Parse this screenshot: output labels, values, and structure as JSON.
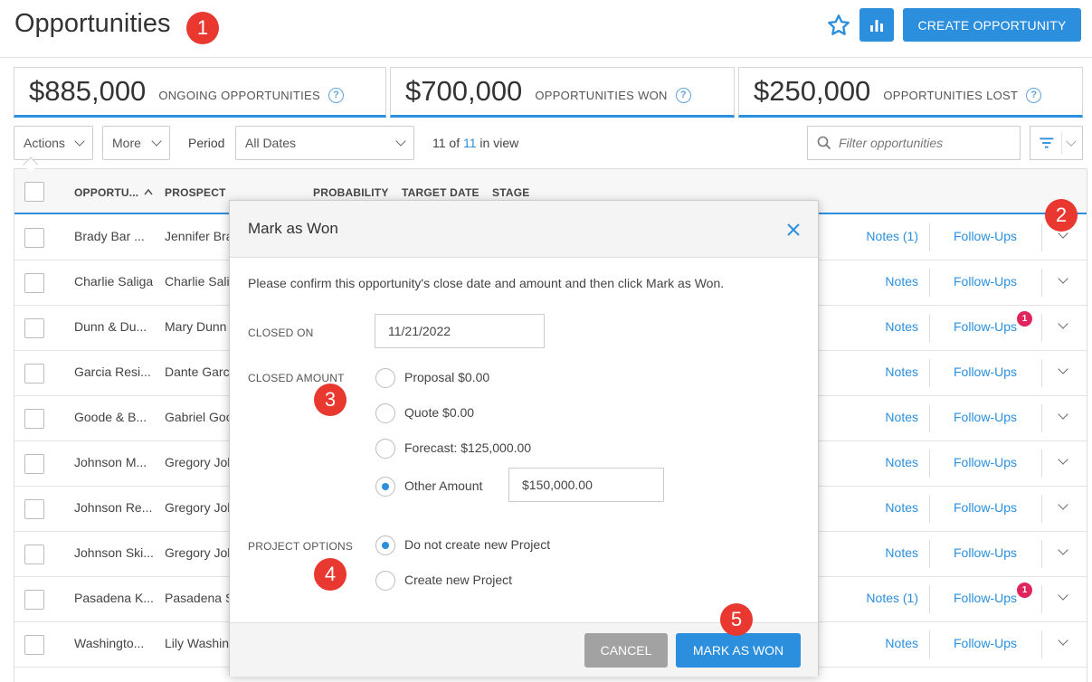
{
  "header": {
    "title": "Opportunities",
    "create_label": "CREATE OPPORTUNITY",
    "star_icon": "star-icon",
    "chart_icon": "bar-chart-icon",
    "accent_color": "#2b8fde"
  },
  "steps": [
    "1",
    "2",
    "3",
    "4",
    "5"
  ],
  "stats": [
    {
      "value": "$885,000",
      "label": "ONGOING OPPORTUNITIES"
    },
    {
      "value": "$700,000",
      "label": "OPPORTUNITIES WON"
    },
    {
      "value": "$250,000",
      "label": "OPPORTUNITIES LOST"
    }
  ],
  "toolbar": {
    "actions_label": "Actions",
    "more_label": "More",
    "period_label": "Period",
    "period_value": "All Dates",
    "in_view_prefix": "11 of ",
    "in_view_total": "11",
    "in_view_suffix": " in view",
    "filter_placeholder": "Filter opportunities"
  },
  "table": {
    "columns": [
      "OPPORTU...",
      "PROSPECT",
      "PROBABILITY",
      "TARGET DATE",
      "STAGE"
    ],
    "sort_icon": "caret-up-icon",
    "rows": [
      {
        "opportunity": "Brady Bar ...",
        "prospect": "Jennifer Bra",
        "notes": "Notes (1)",
        "followups": "Follow-Ups",
        "badge": ""
      },
      {
        "opportunity": "Charlie Saliga",
        "prospect": "Charlie Sali",
        "notes": "Notes",
        "followups": "Follow-Ups",
        "badge": ""
      },
      {
        "opportunity": "Dunn & Du...",
        "prospect": "Mary Dunn",
        "notes": "Notes",
        "followups": "Follow-Ups",
        "badge": "1"
      },
      {
        "opportunity": "Garcia Resi...",
        "prospect": "Dante Garc",
        "notes": "Notes",
        "followups": "Follow-Ups",
        "badge": ""
      },
      {
        "opportunity": "Goode & B...",
        "prospect": "Gabriel Goo",
        "notes": "Notes",
        "followups": "Follow-Ups",
        "badge": ""
      },
      {
        "opportunity": "Johnson M...",
        "prospect": "Gregory Joh",
        "notes": "Notes",
        "followups": "Follow-Ups",
        "badge": ""
      },
      {
        "opportunity": "Johnson Re...",
        "prospect": "Gregory Joh",
        "notes": "Notes",
        "followups": "Follow-Ups",
        "badge": ""
      },
      {
        "opportunity": "Johnson Ski...",
        "prospect": "Gregory Joh",
        "notes": "Notes",
        "followups": "Follow-Ups",
        "badge": ""
      },
      {
        "opportunity": "Pasadena K...",
        "prospect": "Pasadena S",
        "notes": "Notes (1)",
        "followups": "Follow-Ups",
        "badge": "1"
      },
      {
        "opportunity": "Washingto...",
        "prospect": "Lily Washin",
        "notes": "Notes",
        "followups": "Follow-Ups",
        "badge": ""
      }
    ]
  },
  "modal": {
    "title": "Mark as Won",
    "intro": "Please confirm this opportunity's close date and amount and then click Mark as Won.",
    "closed_on_label": "CLOSED ON",
    "closed_on_value": "11/21/2022",
    "closed_amount_label": "CLOSED AMOUNT",
    "amount_options": [
      {
        "label": "Proposal $0.00",
        "selected": false
      },
      {
        "label": "Quote $0.00",
        "selected": false
      },
      {
        "label": "Forecast: $125,000.00",
        "selected": false
      },
      {
        "label": "Other Amount",
        "selected": true
      }
    ],
    "other_amount_value": "$150,000.00",
    "project_options_label": "PROJECT OPTIONS",
    "project_options": [
      {
        "label": "Do not create new Project",
        "selected": true
      },
      {
        "label": "Create new Project",
        "selected": false
      }
    ],
    "cancel_label": "CANCEL",
    "confirm_label": "MARK AS WON"
  }
}
